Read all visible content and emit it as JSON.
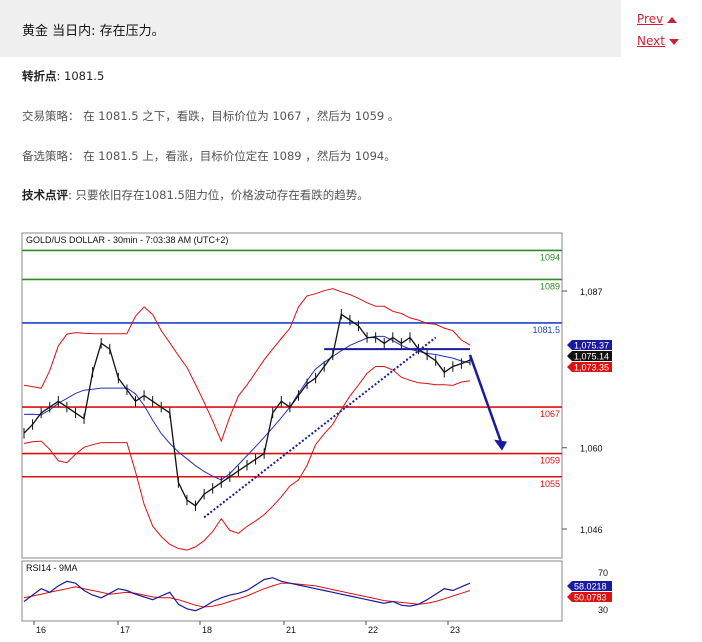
{
  "header": {
    "title": "黄金 当日内: 存在压力。",
    "prev_label": "Prev",
    "next_label": "Next"
  },
  "analysis": {
    "pivot_label": "转折点",
    "pivot_value": ": 1081.5",
    "strategy": "交易策略： 在 1081.5 之下，看跌，目标价位为 1067 ，然后为 1059 。",
    "alternative": "备选策略： 在 1081.5 上，看涨，目标价位定在 1089 ，然后为 1094。",
    "comment_label": "技术点评",
    "comment_text": ": 只要依旧存在1081.5阻力位，价格波动存在看跌的趋势。"
  },
  "chart_data": {
    "type": "line",
    "title": "GOLD/US DOLLAR - 30min - 7:03:38 AM (UTC+2)",
    "x_tick_labels": [
      "16",
      "17",
      "18",
      "21",
      "22",
      "23"
    ],
    "y_tick_labels": [
      "1,087",
      "1,060",
      "1,046"
    ],
    "ylim": [
      1041,
      1097
    ],
    "levels": [
      {
        "label": "1094",
        "value": 1094,
        "color": "#2e8b22"
      },
      {
        "label": "1089",
        "value": 1089,
        "color": "#2e8b22"
      },
      {
        "label": "1081.5",
        "value": 1081.5,
        "color": "#2244cc"
      },
      {
        "label": "1067",
        "value": 1067,
        "color": "#dd1111"
      },
      {
        "label": "1059",
        "value": 1059,
        "color": "#dd1111"
      },
      {
        "label": "1055",
        "value": 1055,
        "color": "#dd1111"
      }
    ],
    "price_badges": [
      {
        "label": "1,075.37",
        "color": "#1a1aa0"
      },
      {
        "label": "1,075.14",
        "color": "#111111"
      },
      {
        "label": "1,073.35",
        "color": "#dd1111"
      }
    ],
    "price_series": [
      1062.5,
      1064,
      1066,
      1067,
      1068,
      1067,
      1066,
      1065,
      1073,
      1078,
      1077,
      1072,
      1070,
      1068,
      1069,
      1068,
      1067,
      1066,
      1054,
      1051,
      1050,
      1052,
      1053,
      1054,
      1055,
      1056,
      1057,
      1058,
      1059,
      1066,
      1068,
      1067,
      1069,
      1071,
      1072,
      1074,
      1076,
      1083,
      1082,
      1081,
      1079,
      1079,
      1078,
      1079,
      1078,
      1079,
      1077,
      1076,
      1075,
      1073,
      1074,
      1074.5,
      1075.1
    ],
    "rsi": {
      "label": "RSI14 - 9MA",
      "ylim": [
        20,
        80
      ],
      "tick_labels": [
        "70",
        "30"
      ],
      "rsi_value_label": "58.0218",
      "ma_value_label": "50.0783",
      "series": [
        38,
        45,
        52,
        48,
        55,
        60,
        58,
        50,
        45,
        42,
        47,
        52,
        50,
        46,
        43,
        40,
        44,
        48,
        35,
        30,
        28,
        32,
        38,
        42,
        45,
        47,
        50,
        56,
        62,
        64,
        60,
        58,
        56,
        54,
        52,
        50,
        48,
        46,
        44,
        42,
        40,
        38,
        36,
        38,
        34,
        33,
        35,
        40,
        46,
        52,
        50,
        54,
        58
      ],
      "ma_series": [
        42,
        44,
        46,
        48,
        50,
        52,
        54,
        52,
        50,
        48,
        46,
        47,
        48,
        47,
        45,
        43,
        42,
        42,
        40,
        37,
        34,
        32,
        33,
        35,
        38,
        41,
        44,
        48,
        52,
        55,
        58,
        58,
        57,
        56,
        55,
        53,
        51,
        49,
        47,
        45,
        43,
        41,
        39,
        38,
        37,
        36,
        35,
        36,
        38,
        41,
        44,
        47,
        50
      ]
    }
  }
}
